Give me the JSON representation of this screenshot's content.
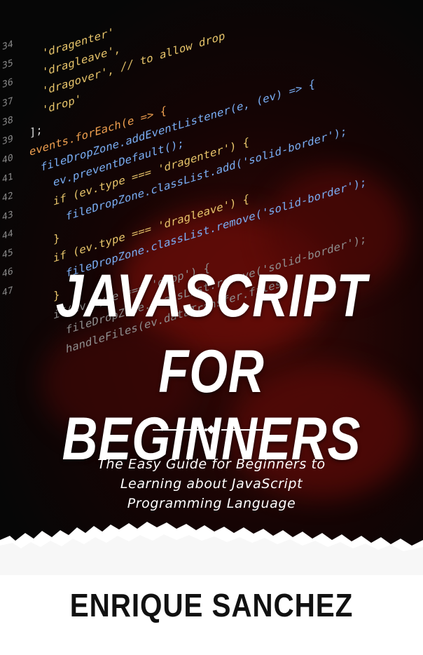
{
  "cover": {
    "title_line1": "JAVASCRIPT",
    "title_line2": "FOR BEGINNERS",
    "subtitle_line1": "The Easy Guide for Beginners to",
    "subtitle_line2": "Learning about JavaScript",
    "subtitle_line3": "Programming Language",
    "author": "ENRIQUE SANCHEZ",
    "colors": {
      "background_dark": "#060606",
      "fire_red": "#6e0d08",
      "title_text": "#ffffff",
      "author_text": "#111111"
    }
  },
  "code_background": {
    "lines": [
      {
        "number": "34",
        "text": "'dragenter'"
      },
      {
        "number": "35",
        "text": "'dragleave',"
      },
      {
        "number": "36",
        "text": "'dragover', // to allow drop"
      },
      {
        "number": "37",
        "text": "'drop'"
      },
      {
        "number": "38",
        "text": "];"
      },
      {
        "number": "39",
        "text": "events.forEach(e => {"
      },
      {
        "number": "40",
        "text": "fileDropZone.addEventListener(e, (ev) => {"
      },
      {
        "number": "41",
        "text": "ev.preventDefault();"
      },
      {
        "number": "42",
        "text": "if (ev.type === 'dragenter') {"
      },
      {
        "number": "43",
        "text": "fileDropZone.classList.add('solid-border');"
      },
      {
        "number": "44",
        "text": "}"
      },
      {
        "number": "45",
        "text": "if (ev.type === 'dragleave') {"
      },
      {
        "number": "46",
        "text": "fileDropZone.classList.remove('solid-border');"
      },
      {
        "number": "47",
        "text": "}"
      },
      {
        "number": "",
        "text": "if(ev.type === 'drop') {"
      },
      {
        "number": "",
        "text": "fileDropZone.classList.remove('solid-border');"
      },
      {
        "number": "",
        "text": "handleFiles(ev.dataTransfer.files)"
      }
    ]
  }
}
